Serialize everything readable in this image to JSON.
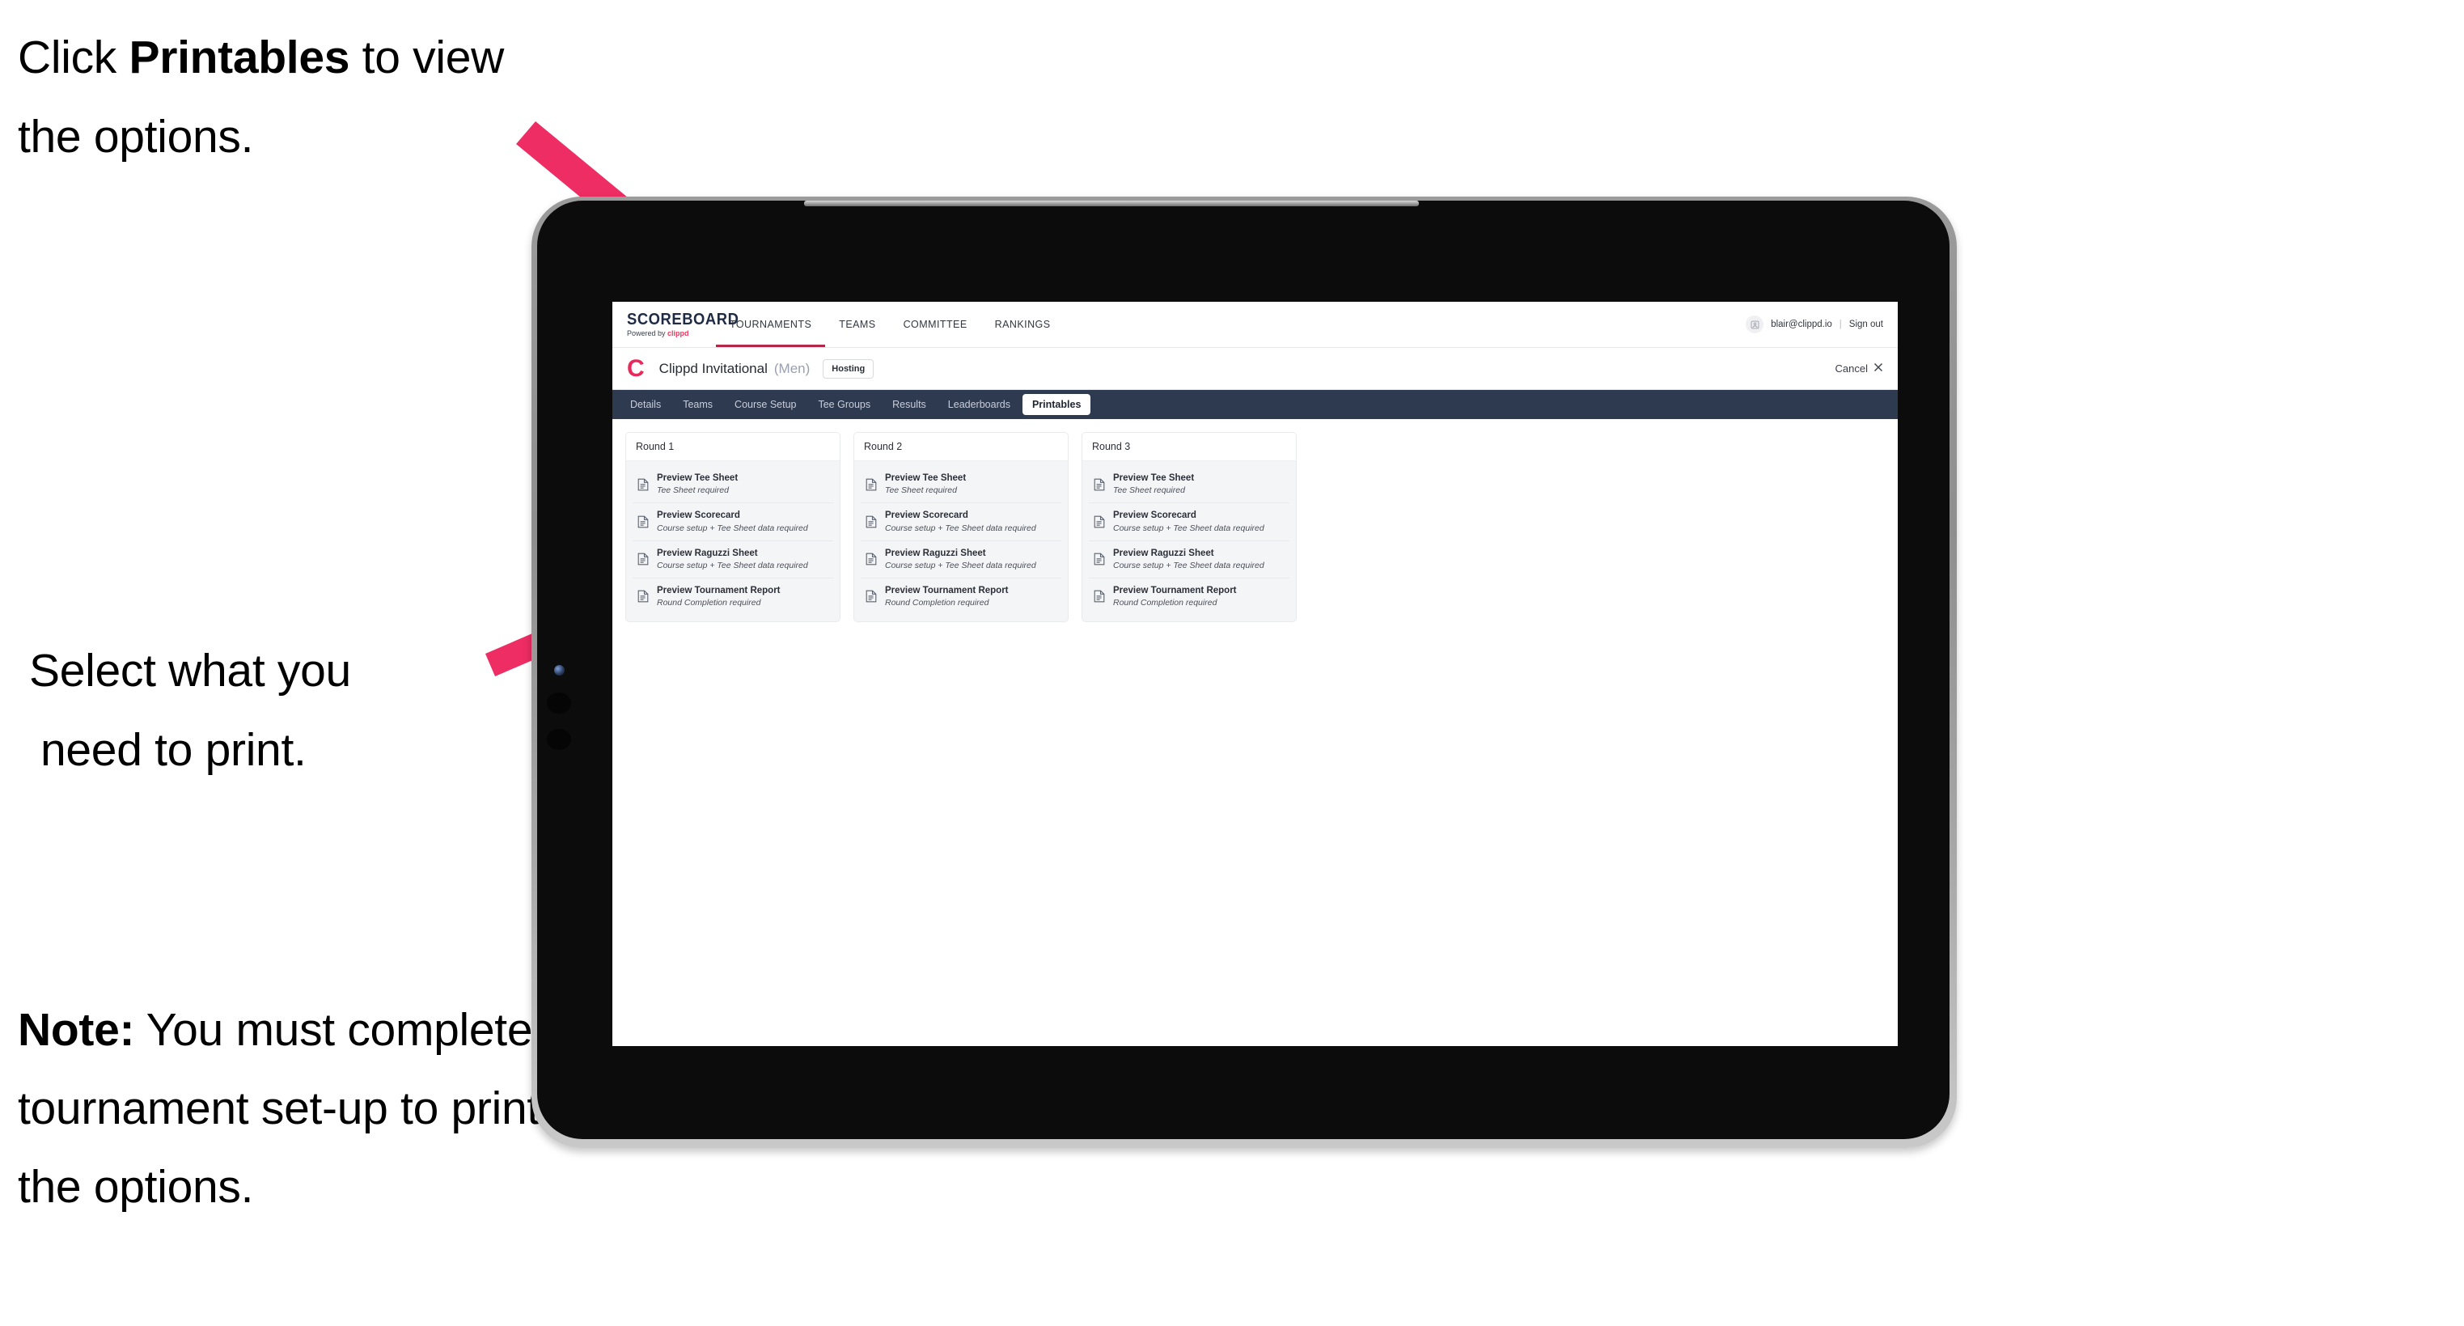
{
  "annotations": {
    "top": {
      "pre": "Click ",
      "bold": "Printables",
      "post": " to view the options."
    },
    "mid": {
      "line1": "Select what you",
      "line2": "need to print."
    },
    "note": {
      "bold": "Note:",
      "rest": " You must complete the tournament set-up to print all the options."
    }
  },
  "colors": {
    "arrow_pink": "#ED2D63",
    "tabstrip_navy": "#2E3A50",
    "brand_pink": "#E8295B",
    "active_nav_underline": "#B3284A"
  },
  "browser": {
    "appbar": {
      "logo_word": "SCOREBOARD",
      "logo_sub_prefix": "Powered by ",
      "logo_sub_brand": "clippd",
      "nav_items": [
        {
          "label": "TOURNAMENTS",
          "active": true
        },
        {
          "label": "TEAMS",
          "active": false
        },
        {
          "label": "COMMITTEE",
          "active": false
        },
        {
          "label": "RANKINGS",
          "active": false
        }
      ],
      "avatar_icon": "user-avatar-icon",
      "user_email": "blair@clippd.io",
      "separator": "|",
      "sign_out": "Sign out"
    },
    "titlebar": {
      "brand_initial": "C",
      "tournament_name": "Clippd Invitational",
      "gender": "(Men)",
      "badge": "Hosting",
      "cancel_label": "Cancel",
      "cancel_icon": "close-x-icon"
    },
    "tabs": [
      {
        "label": "Details",
        "active": false
      },
      {
        "label": "Teams",
        "active": false
      },
      {
        "label": "Course Setup",
        "active": false
      },
      {
        "label": "Tee Groups",
        "active": false
      },
      {
        "label": "Results",
        "active": false
      },
      {
        "label": "Leaderboards",
        "active": false
      },
      {
        "label": "Printables",
        "active": true
      }
    ],
    "rounds": [
      {
        "title": "Round 1",
        "items": [
          {
            "title": "Preview Tee Sheet",
            "sub": "Tee Sheet required",
            "icon": "document-icon"
          },
          {
            "title": "Preview Scorecard",
            "sub": "Course setup + Tee Sheet data required",
            "icon": "document-icon"
          },
          {
            "title": "Preview Raguzzi Sheet",
            "sub": "Course setup + Tee Sheet data required",
            "icon": "document-icon"
          },
          {
            "title": "Preview Tournament Report",
            "sub": "Round Completion required",
            "icon": "document-icon"
          }
        ]
      },
      {
        "title": "Round 2",
        "items": [
          {
            "title": "Preview Tee Sheet",
            "sub": "Tee Sheet required",
            "icon": "document-icon"
          },
          {
            "title": "Preview Scorecard",
            "sub": "Course setup + Tee Sheet data required",
            "icon": "document-icon"
          },
          {
            "title": "Preview Raguzzi Sheet",
            "sub": "Course setup + Tee Sheet data required",
            "icon": "document-icon"
          },
          {
            "title": "Preview Tournament Report",
            "sub": "Round Completion required",
            "icon": "document-icon"
          }
        ]
      },
      {
        "title": "Round 3",
        "items": [
          {
            "title": "Preview Tee Sheet",
            "sub": "Tee Sheet required",
            "icon": "document-icon"
          },
          {
            "title": "Preview Scorecard",
            "sub": "Course setup + Tee Sheet data required",
            "icon": "document-icon"
          },
          {
            "title": "Preview Raguzzi Sheet",
            "sub": "Course setup + Tee Sheet data required",
            "icon": "document-icon"
          },
          {
            "title": "Preview Tournament Report",
            "sub": "Round Completion required",
            "icon": "document-icon"
          }
        ]
      }
    ]
  }
}
